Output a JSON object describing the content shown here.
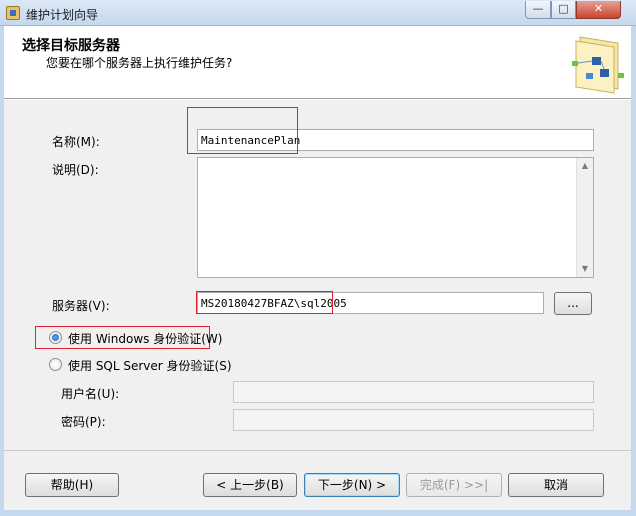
{
  "window": {
    "title": "维护计划向导",
    "minimize": "—",
    "maximize": "□",
    "close": "✕"
  },
  "header": {
    "title": "选择目标服务器",
    "subtitle": "您要在哪个服务器上执行维护任务?"
  },
  "form": {
    "name_label": "名称(M):",
    "name_value": "MaintenancePlan",
    "description_label": "说明(D):",
    "description_value": "",
    "server_label": "服务器(V):",
    "server_value": "MS20180427BFAZ\\sql2005",
    "browse_label": "...",
    "auth_windows_label": "使用 Windows 身份验证(W)",
    "auth_sql_label": "使用 SQL Server 身份验证(S)",
    "username_label": "用户名(U):",
    "username_value": "",
    "password_label": "密码(P):",
    "password_value": ""
  },
  "footer": {
    "help": "帮助(H)",
    "back": "< 上一步(B)",
    "next": "下一步(N) >",
    "finish": "完成(F) >>|",
    "cancel": "取消"
  },
  "colors": {
    "highlight": "#e0202a",
    "dialog_bg": "#f0f0f0"
  }
}
